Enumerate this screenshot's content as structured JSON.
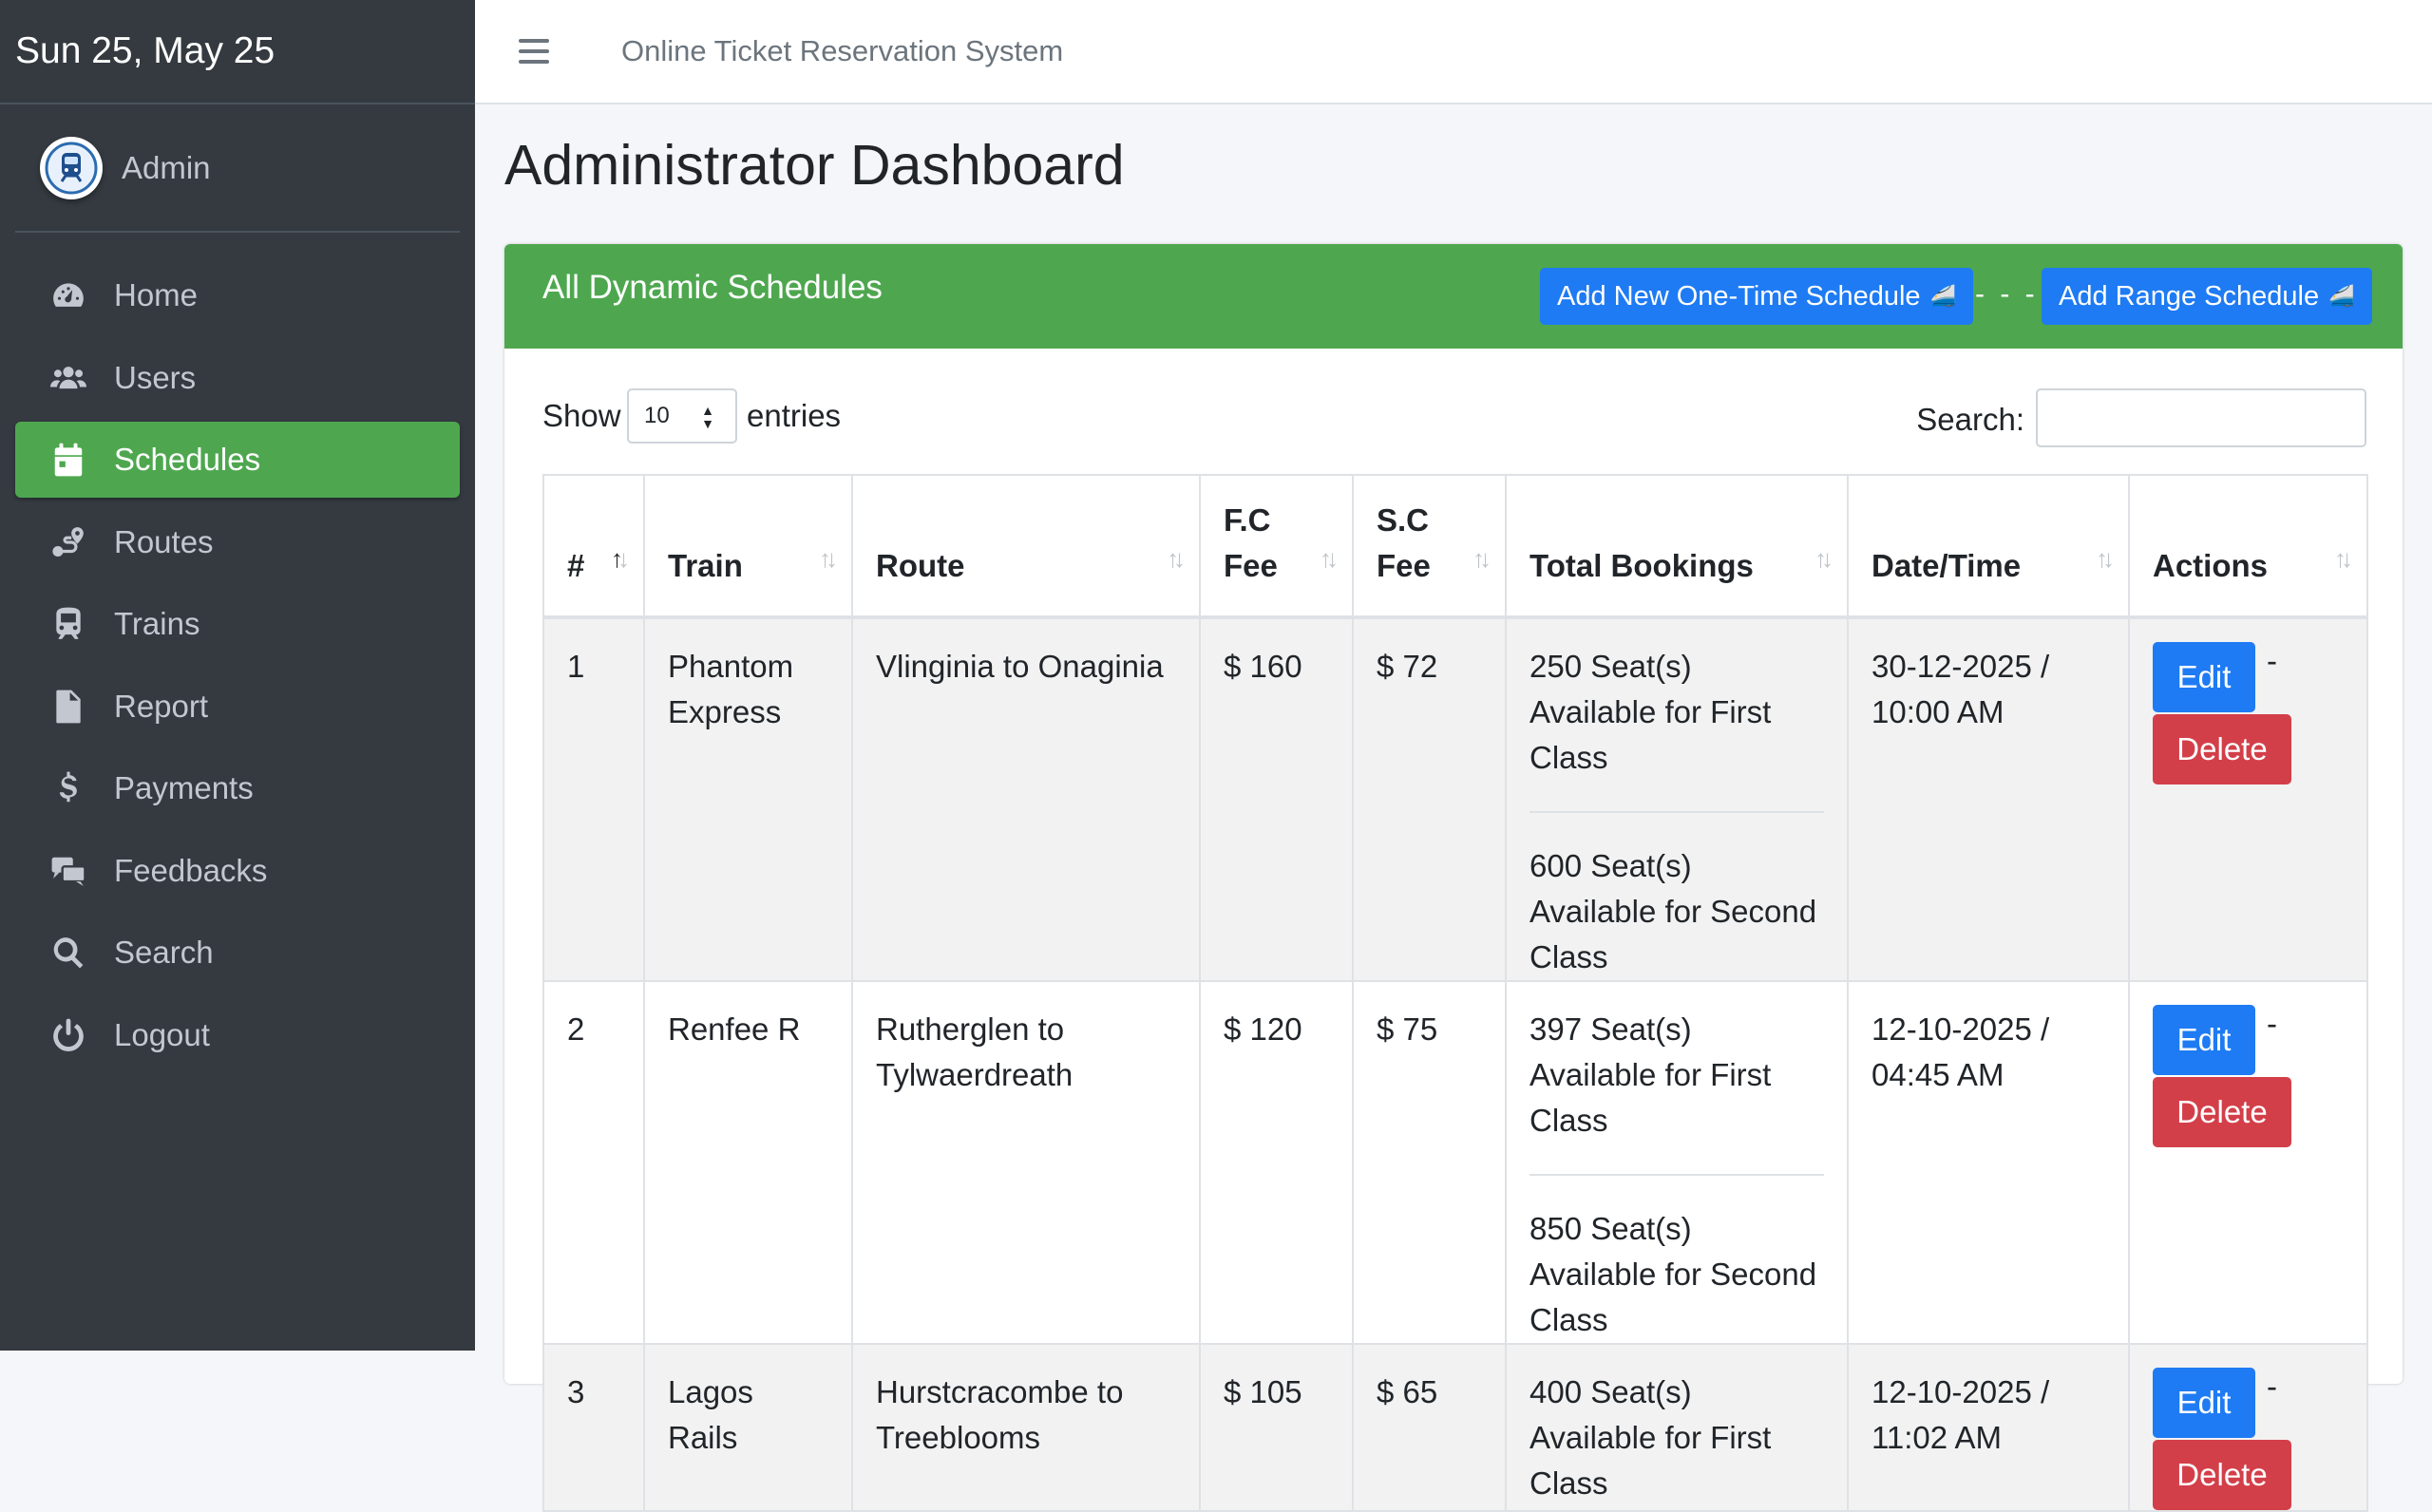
{
  "sidebar": {
    "brand_text": "Sun 25, May 25",
    "user_name": "Admin",
    "items": [
      {
        "label": "Home",
        "icon": "dashboard-icon"
      },
      {
        "label": "Users",
        "icon": "users-icon"
      },
      {
        "label": "Schedules",
        "icon": "calendar-icon",
        "active": true
      },
      {
        "label": "Routes",
        "icon": "route-icon"
      },
      {
        "label": "Trains",
        "icon": "train-icon"
      },
      {
        "label": "Report",
        "icon": "pdf-file-icon"
      },
      {
        "label": "Payments",
        "icon": "dollar-icon"
      },
      {
        "label": "Feedbacks",
        "icon": "comments-icon"
      },
      {
        "label": "Search",
        "icon": "search-icon"
      },
      {
        "label": "Logout",
        "icon": "power-icon"
      }
    ]
  },
  "topbar": {
    "app_title": "Online Ticket Reservation System"
  },
  "page": {
    "title": "Administrator Dashboard"
  },
  "card": {
    "title": "All Dynamic Schedules",
    "add_one_time_label": "Add New One-Time Schedule",
    "separator": "- - -",
    "add_range_label": "Add Range Schedule"
  },
  "table_controls": {
    "show_label": "Show",
    "entries_value": "10",
    "entries_label": "entries",
    "search_label": "Search:",
    "search_value": ""
  },
  "table": {
    "headers": [
      "#",
      "Train",
      "Route",
      "F.C Fee",
      "S.C Fee",
      "Total Bookings",
      "Date/Time",
      "Actions"
    ],
    "rows": [
      {
        "num": "1",
        "train": "Phantom Express",
        "route": "Vlinginia to Onaginia",
        "fc_fee": "$ 160",
        "sc_fee": "$ 72",
        "fc_seats": "250 Seat(s) Available for First Class",
        "sc_seats": "600 Seat(s) Available for Second Class",
        "datetime": "30-12-2025 / 10:00 AM"
      },
      {
        "num": "2",
        "train": "Renfee R",
        "route": "Rutherglen to Tylwaerdreath",
        "fc_fee": "$ 120",
        "sc_fee": "$ 75",
        "fc_seats": "397 Seat(s) Available for First Class",
        "sc_seats": "850 Seat(s) Available for Second Class",
        "datetime": "12-10-2025 / 04:45 AM"
      },
      {
        "num": "3",
        "train": "Lagos Rails",
        "route": "Hurstcracombe to Treeblooms",
        "fc_fee": "$ 105",
        "sc_fee": "$ 65",
        "fc_seats": "400 Seat(s) Available for First Class",
        "sc_seats": "",
        "datetime": "12-10-2025 / 11:02 AM"
      }
    ],
    "edit_label": "Edit",
    "delete_label": "Delete",
    "action_separator": "-"
  },
  "colors": {
    "sidebar_bg": "#343a40",
    "accent_green": "#4ea74f",
    "primary_blue": "#1e7bf3",
    "danger_red": "#d33f49"
  }
}
